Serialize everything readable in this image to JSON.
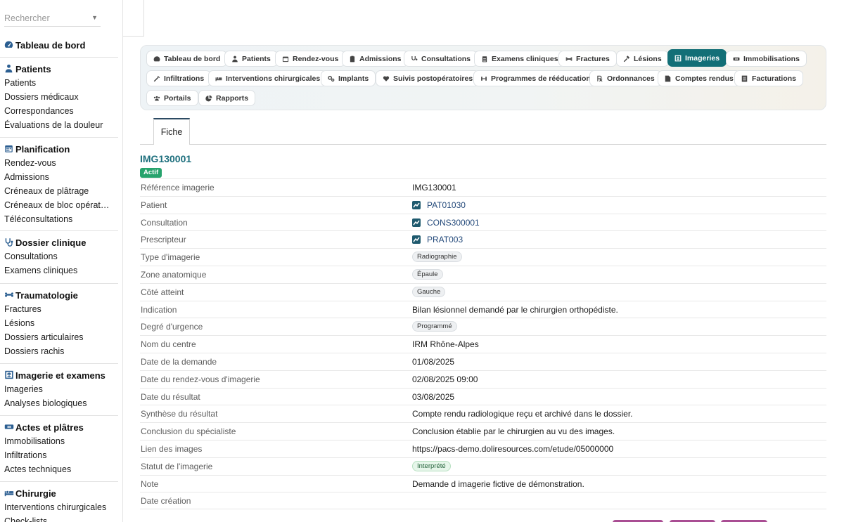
{
  "sidebar": {
    "search_placeholder": "Rechercher",
    "dashboard": "Tableau de bord",
    "sections": [
      {
        "title": "Patients",
        "items": [
          "Patients",
          "Dossiers médicaux",
          "Correspondances",
          "Évaluations de la douleur"
        ]
      },
      {
        "title": "Planification",
        "items": [
          "Rendez-vous",
          "Admissions",
          "Créneaux de plâtrage",
          "Créneaux de bloc opérat…",
          "Téléconsultations"
        ]
      },
      {
        "title": "Dossier clinique",
        "items": [
          "Consultations",
          "Examens cliniques"
        ]
      },
      {
        "title": "Traumatologie",
        "items": [
          "Fractures",
          "Lésions",
          "Dossiers articulaires",
          "Dossiers rachis"
        ]
      },
      {
        "title": "Imagerie et examens",
        "items": [
          "Imageries",
          "Analyses biologiques"
        ]
      },
      {
        "title": "Actes et plâtres",
        "items": [
          "Immobilisations",
          "Infiltrations",
          "Actes techniques"
        ]
      },
      {
        "title": "Chirurgie",
        "items": [
          "Interventions chirurgicales",
          "Check-lists"
        ]
      }
    ]
  },
  "modules": {
    "row1": [
      "Tableau de bord",
      "Patients",
      "Rendez-vous",
      "Admissions",
      "Consultations",
      "Examens cliniques",
      "Fractures",
      "Lésions",
      "Imageries",
      "Immobilisations"
    ],
    "row2": [
      "Infiltrations",
      "Interventions chirurgicales",
      "Implants",
      "Suivis postopératoires",
      "Programmes de rééducation",
      "Ordonnances",
      "Comptes rendus",
      "Facturations"
    ],
    "row3": [
      "Portails",
      "Rapports"
    ],
    "active": "Imageries"
  },
  "tabs": {
    "fiche": "Fiche"
  },
  "record": {
    "ref": "IMG130001",
    "status": "Actif",
    "fields": [
      {
        "label": "Référence imagerie",
        "value": "IMG130001"
      },
      {
        "label": "Patient",
        "value": "PAT01030"
      },
      {
        "label": "Consultation",
        "value": "CONS300001"
      },
      {
        "label": "Prescripteur",
        "value": "PRAT003"
      },
      {
        "label": "Type d'imagerie",
        "value": "Radiographie"
      },
      {
        "label": "Zone anatomique",
        "value": "Épaule"
      },
      {
        "label": "Côté atteint",
        "value": "Gauche"
      },
      {
        "label": "Indication",
        "value": "Bilan lésionnel demandé par le chirurgien orthopédiste."
      },
      {
        "label": "Degré d'urgence",
        "value": "Programmé"
      },
      {
        "label": "Nom du centre",
        "value": "IRM Rhône-Alpes"
      },
      {
        "label": "Date de la demande",
        "value": "01/08/2025"
      },
      {
        "label": "Date du rendez-vous d'imagerie",
        "value": "02/08/2025 09:00"
      },
      {
        "label": "Date du résultat",
        "value": "03/08/2025"
      },
      {
        "label": "Synthèse du résultat",
        "value": "Compte rendu radiologique reçu et archivé dans le dossier."
      },
      {
        "label": "Conclusion du spécialiste",
        "value": "Conclusion établie par le chirurgien au vu des images."
      },
      {
        "label": "Lien des images",
        "value": "https://pacs-demo.doliresources.com/etude/05000000"
      },
      {
        "label": "Statut de l'imagerie",
        "value": "Interprété"
      },
      {
        "label": "Note",
        "value": "Demande d imagerie fictive de démonstration."
      },
      {
        "label": "Date création",
        "value": ""
      }
    ]
  },
  "colors": {
    "accent": "#136f77",
    "ref": "#1d6f7d",
    "badge": "#27a36d",
    "link": "#23497a"
  }
}
